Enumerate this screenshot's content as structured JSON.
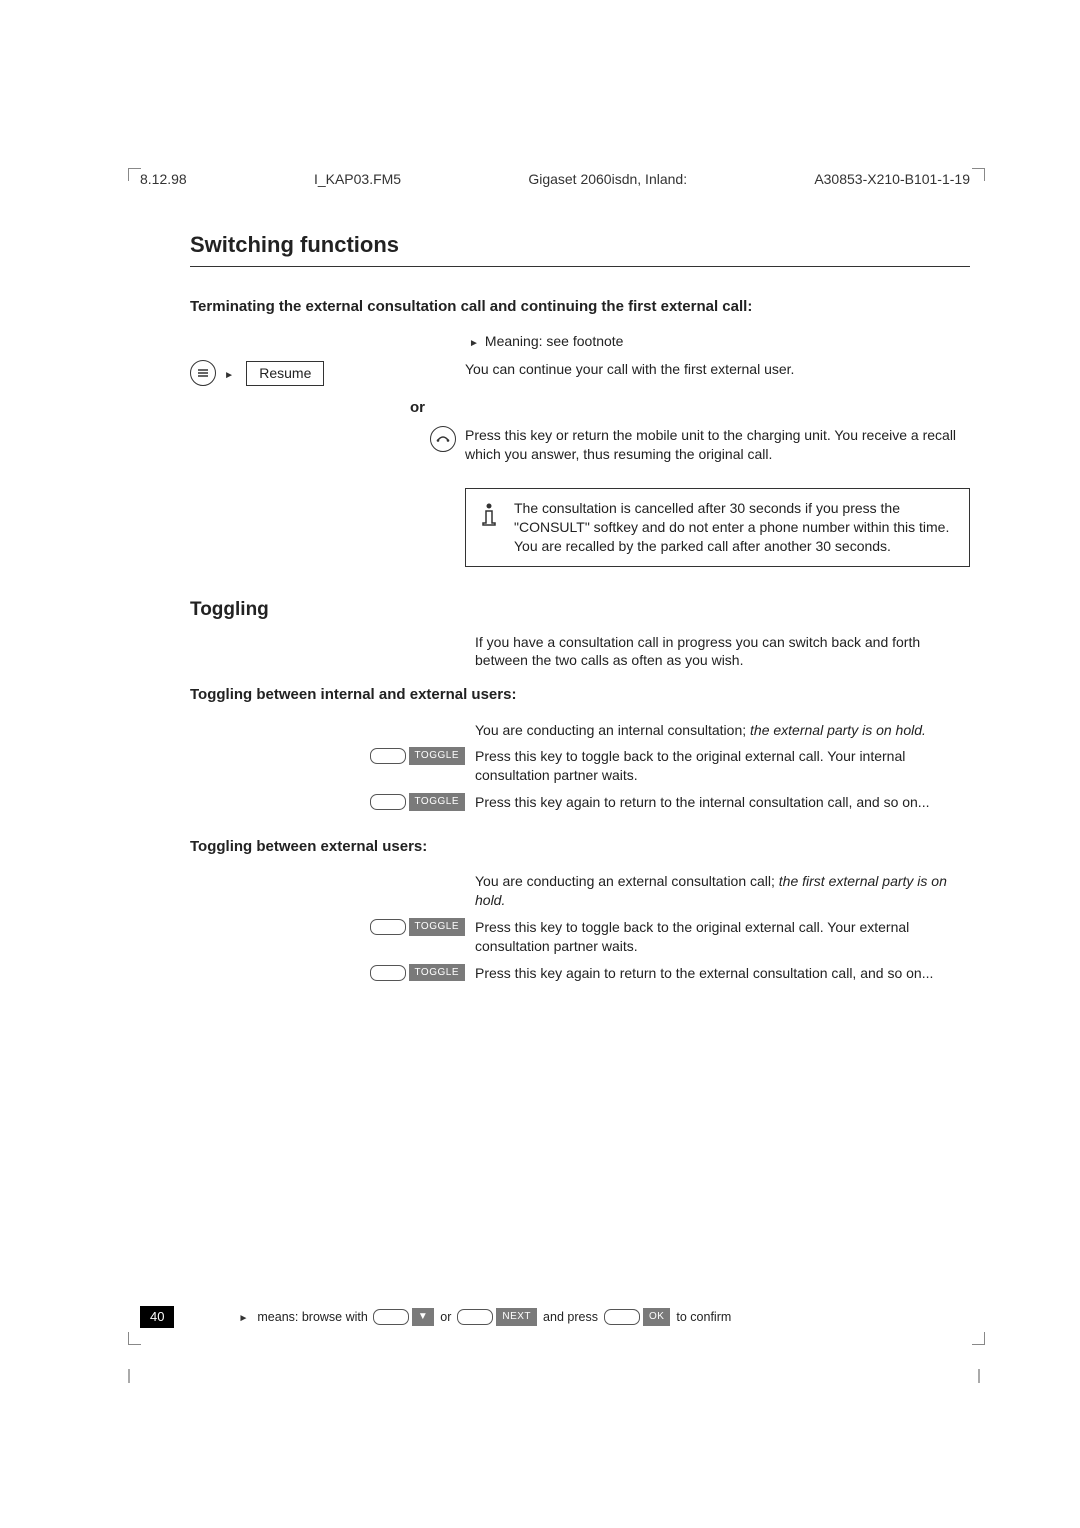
{
  "header": {
    "date": "8.12.98",
    "file": "I_KAP03.FM5",
    "title": "Gigaset 2060isdn, Inland:",
    "docnum": "A30853-X210-B101-1-19"
  },
  "section_title": "Switching functions",
  "term_subhead": "Terminating the external consultation call and continuing the first external call:",
  "resume_label": "Resume",
  "meaning_text": "Meaning: see footnote",
  "continue_text": "You can continue your call with the first external user.",
  "or_label": "or",
  "press_key_text": "Press this key or return the mobile unit to the charging unit. You receive a recall which you answer, thus resuming the original call.",
  "note_text": "The consultation is cancelled after 30 seconds if you press the \"CONSULT\" softkey and do not enter a phone number within this time. You are recalled by the parked call after another 30 seconds.",
  "toggling_title": "Toggling",
  "toggling_intro": "If you have a consultation call in progress you can switch back and forth between the two calls as often as you wish.",
  "toggle_int_ext_head": "Toggling between internal and external users:",
  "int_ext_lines": {
    "l1a": "You are conducting an internal consultation; ",
    "l1b": "the external party is on hold.",
    "l2": "Press this key to toggle back to the original external call. Your internal consultation partner waits.",
    "l3": "Press this key again to return to the internal consultation call, and so on..."
  },
  "toggle_ext_head": "Toggling between external users:",
  "ext_lines": {
    "l1a": "You are conducting an external consultation call; ",
    "l1b": "the first external party is on hold.",
    "l2": "Press this key to toggle back to the original external call. Your external consultation partner waits.",
    "l3": "Press this key again to return to the external consultation call, and so on..."
  },
  "toggle_key": "TOGGLE",
  "footer": {
    "page": "40",
    "t1": "means: browse with",
    "or": "or",
    "next": "NEXT",
    "t2": "and press",
    "ok": "OK",
    "t3": "to confirm"
  }
}
